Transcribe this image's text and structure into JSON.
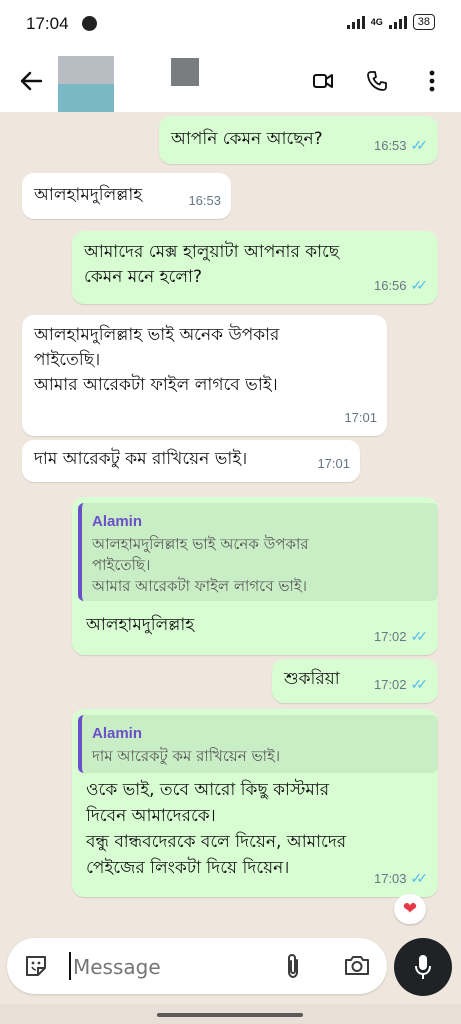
{
  "status_bar": {
    "time": "17:04",
    "network": "4G",
    "battery": "38",
    "icons": [
      "messenger-icon",
      "signal-icon",
      "battery-icon"
    ]
  },
  "header": {
    "back_icon": "arrow-left-icon",
    "video_icon": "video-call-icon",
    "call_icon": "phone-icon",
    "menu_icon": "more-vertical-icon"
  },
  "messages": [
    {
      "dir": "out",
      "text": "আপনি কেমন আছেন?",
      "time": "16:53",
      "read": true
    },
    {
      "dir": "in",
      "text": "আলহামদুলিল্লাহ",
      "time": "16:53"
    },
    {
      "dir": "out",
      "text": "আমাদের মেক্স হালুয়াটা আপনার কাছে\nকেমন মনে হলো?",
      "time": "16:56",
      "read": true
    },
    {
      "dir": "in",
      "text": "আলহামদুলিল্লাহ ভাই অনেক উপকার\nপাইতেছি।\nআমার আরেকটা ফাইল লাগবে ভাই।",
      "time": "17:01"
    },
    {
      "dir": "in",
      "text": "দাম আরেকটু কম রাখিয়েন ভাই।",
      "time": "17:01"
    },
    {
      "dir": "out",
      "quote_author": "Alamin",
      "quote_text": "আলহামদুলিল্লাহ ভাই অনেক উপকার\nপাইতেছি।\nআমার আরেকটা ফাইল লাগবে ভাই।",
      "text": "আলহামদুলিল্লাহ",
      "time": "17:02",
      "read": true
    },
    {
      "dir": "out",
      "text": "শুকরিয়া",
      "time": "17:02",
      "read": true
    },
    {
      "dir": "out",
      "quote_author": "Alamin",
      "quote_text": "দাম আরেকটু কম রাখিয়েন ভাই।",
      "text": "ওকে ভাই,  তবে আরো কিছু কাস্টমার\nদিবেন আমাদেরকে।\nবন্ধু বান্ধবদেরকে বলে দিয়েন, আমাদের\nপেইজের লিংকটা দিয়ে দিয়েন।",
      "time": "17:03",
      "read": true
    }
  ],
  "reaction": "❤",
  "composer": {
    "placeholder": "Message",
    "icons": [
      "sticker-icon",
      "attach-icon",
      "camera-icon",
      "mic-icon"
    ]
  },
  "colors": {
    "outgoing_bubble": "#d9fdd3",
    "incoming_bubble": "#ffffff",
    "read_ticks": "#53bdeb",
    "quote_accent": "#6b4fc9",
    "chat_background": "#efe7dd"
  }
}
